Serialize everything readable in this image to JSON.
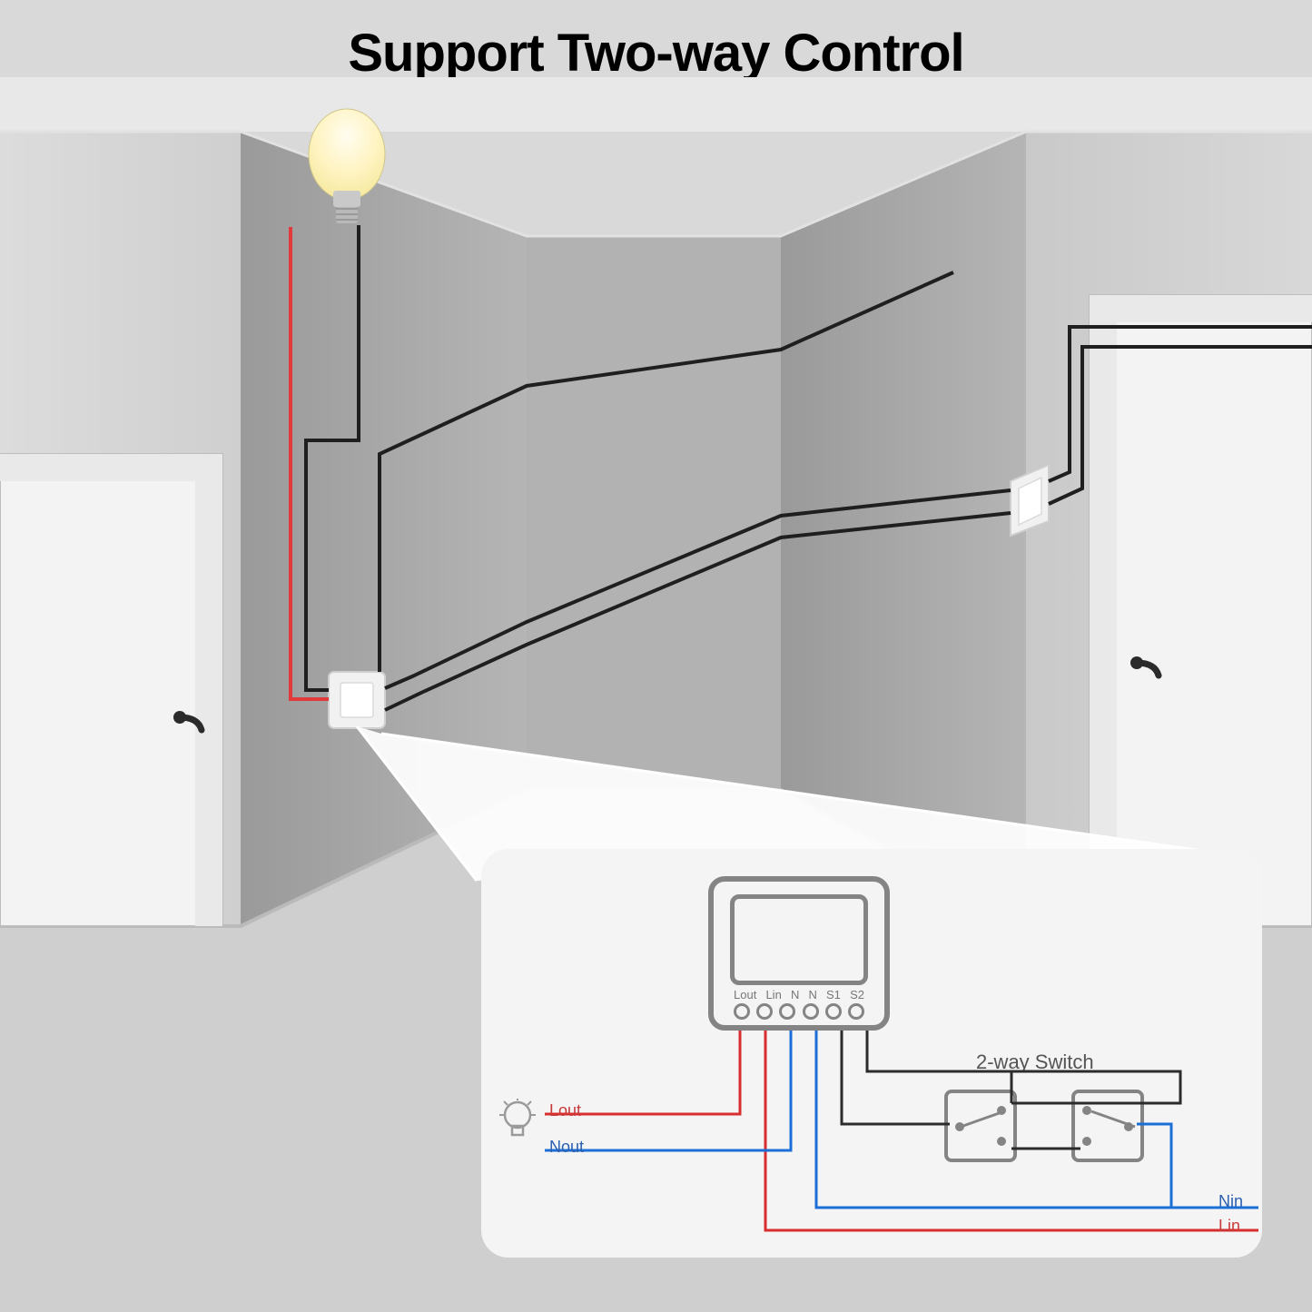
{
  "title": "Support Two-way Control",
  "schematic": {
    "switch_title": "2-way Switch",
    "labels": {
      "lout": "Lout",
      "nout": "Nout",
      "nin": "Nin",
      "lin": "Lin"
    },
    "terminals": [
      "Lout",
      "Lin",
      "N",
      "N",
      "S1",
      "S2"
    ]
  },
  "colors": {
    "wire_red": "#e63946",
    "wire_blue": "#1d4ed8",
    "wire_black": "#2b2b2b",
    "wire_dark": "#1a1a1a",
    "module_gray": "#848484",
    "wall_light": "#d7d7d7",
    "wall_mid": "#b9b9b9",
    "wall_dark": "#a0a0a0",
    "floor": "#c8c8c8"
  }
}
